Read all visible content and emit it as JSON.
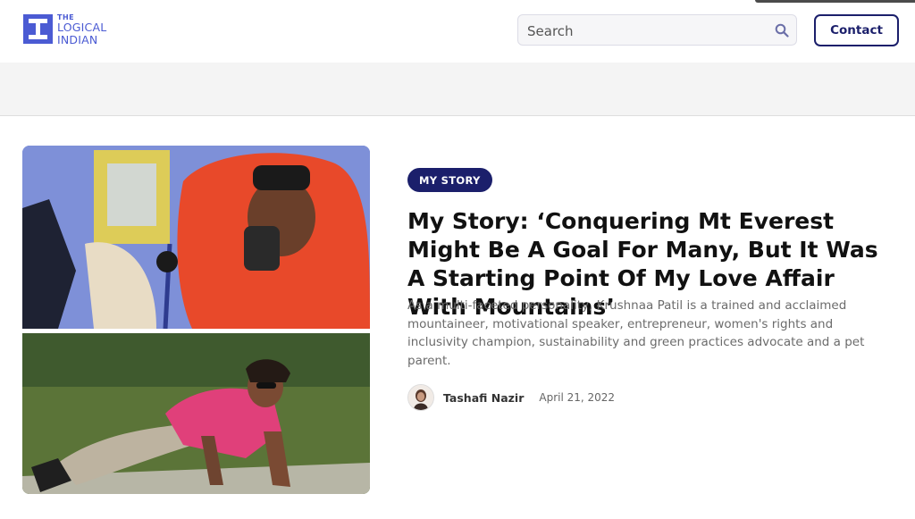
{
  "header": {
    "logo": {
      "line1": "THE",
      "line2": "LOGICAL",
      "line3": "INDIAN"
    },
    "search": {
      "placeholder": "Search"
    },
    "contact_label": "Contact"
  },
  "article": {
    "category": "MY STORY",
    "title": "My Story: ‘Conquering Mt Everest Might Be A Goal For Many, But It Was A Starting Point Of My Love Affair With Mountains’",
    "excerpt": "As a multi-faceted personality, Krushnaa Patil is a trained and acclaimed mountaineer, motivational speaker, entrepreneur, women's rights and inclusivity champion, sustainability and green practices advocate and a pet parent.",
    "author": "Tashafi Nazir",
    "date": "April 21, 2022"
  },
  "colors": {
    "brand": "#4b5bd3",
    "navy": "#1b1f6b",
    "band": "#f4f4f4"
  },
  "icons": {
    "search": "search-icon"
  }
}
